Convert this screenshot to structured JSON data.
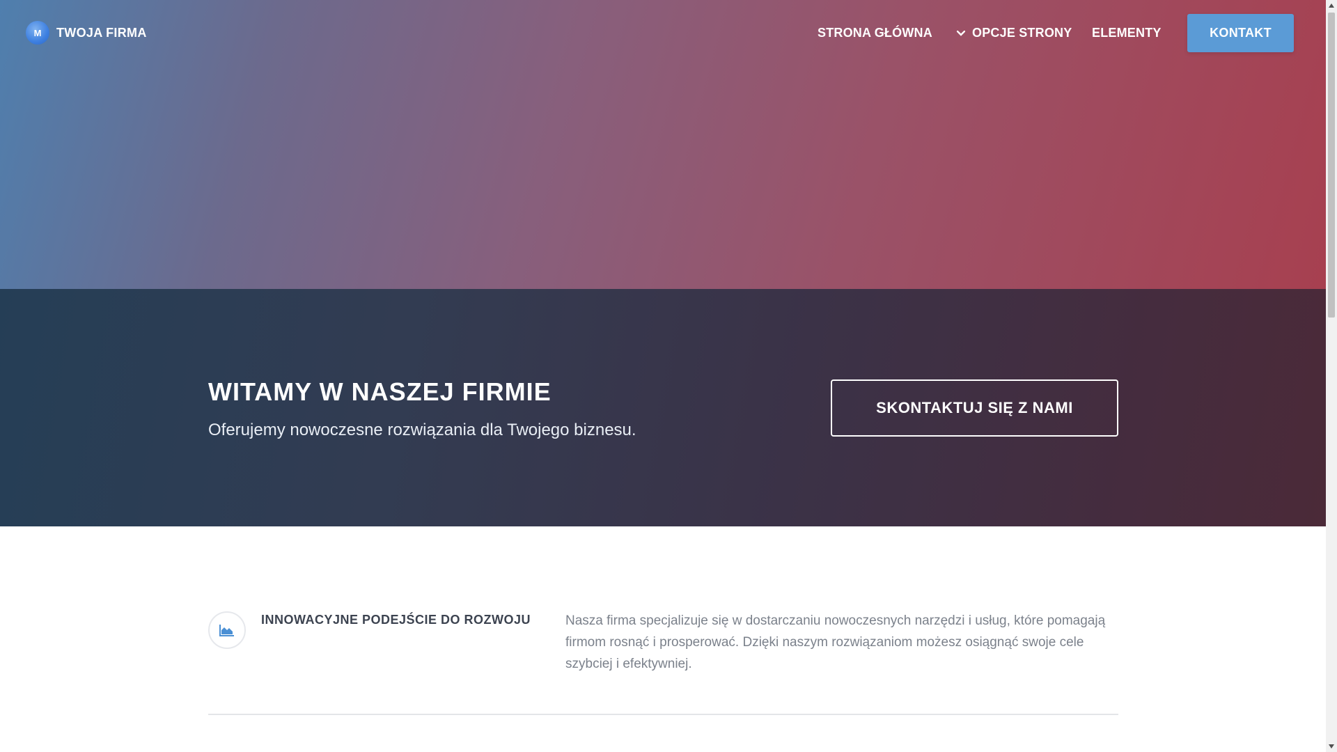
{
  "brand": {
    "logo_text": "M",
    "name": "TWOJA FIRMA"
  },
  "nav": {
    "items": [
      {
        "label": "STRONA GŁÓWNA"
      },
      {
        "label": "OPCJE STRONY"
      },
      {
        "label": "ELEMENTY"
      }
    ],
    "cta_label": "KONTAKT"
  },
  "welcome": {
    "title": "WITAMY W NASZEJ FIRMIE",
    "subtitle": "Oferujemy nowoczesne rozwiązania dla Twojego biznesu.",
    "button_label": "SKONTAKTUJ SIĘ Z NAMI"
  },
  "feature": {
    "icon": "area-chart-icon",
    "title": "INNOWACYJNE PODEJŚCIE DO ROZWOJU",
    "text": "Nasza firma specjalizuje się w dostarczaniu nowoczesnych narzędzi i usług, które pomagają firmom rosnąć i prosperować. Dzięki naszym rozwiązaniom możesz osiągnąć swoje cele szybciej i efektywniej."
  },
  "colors": {
    "accent": "#5b9bd6",
    "hero_gradient_start": "#4f7fae",
    "hero_gradient_end": "#a74050",
    "band_gradient_start": "#253e56",
    "band_gradient_end": "#4b2a38"
  }
}
